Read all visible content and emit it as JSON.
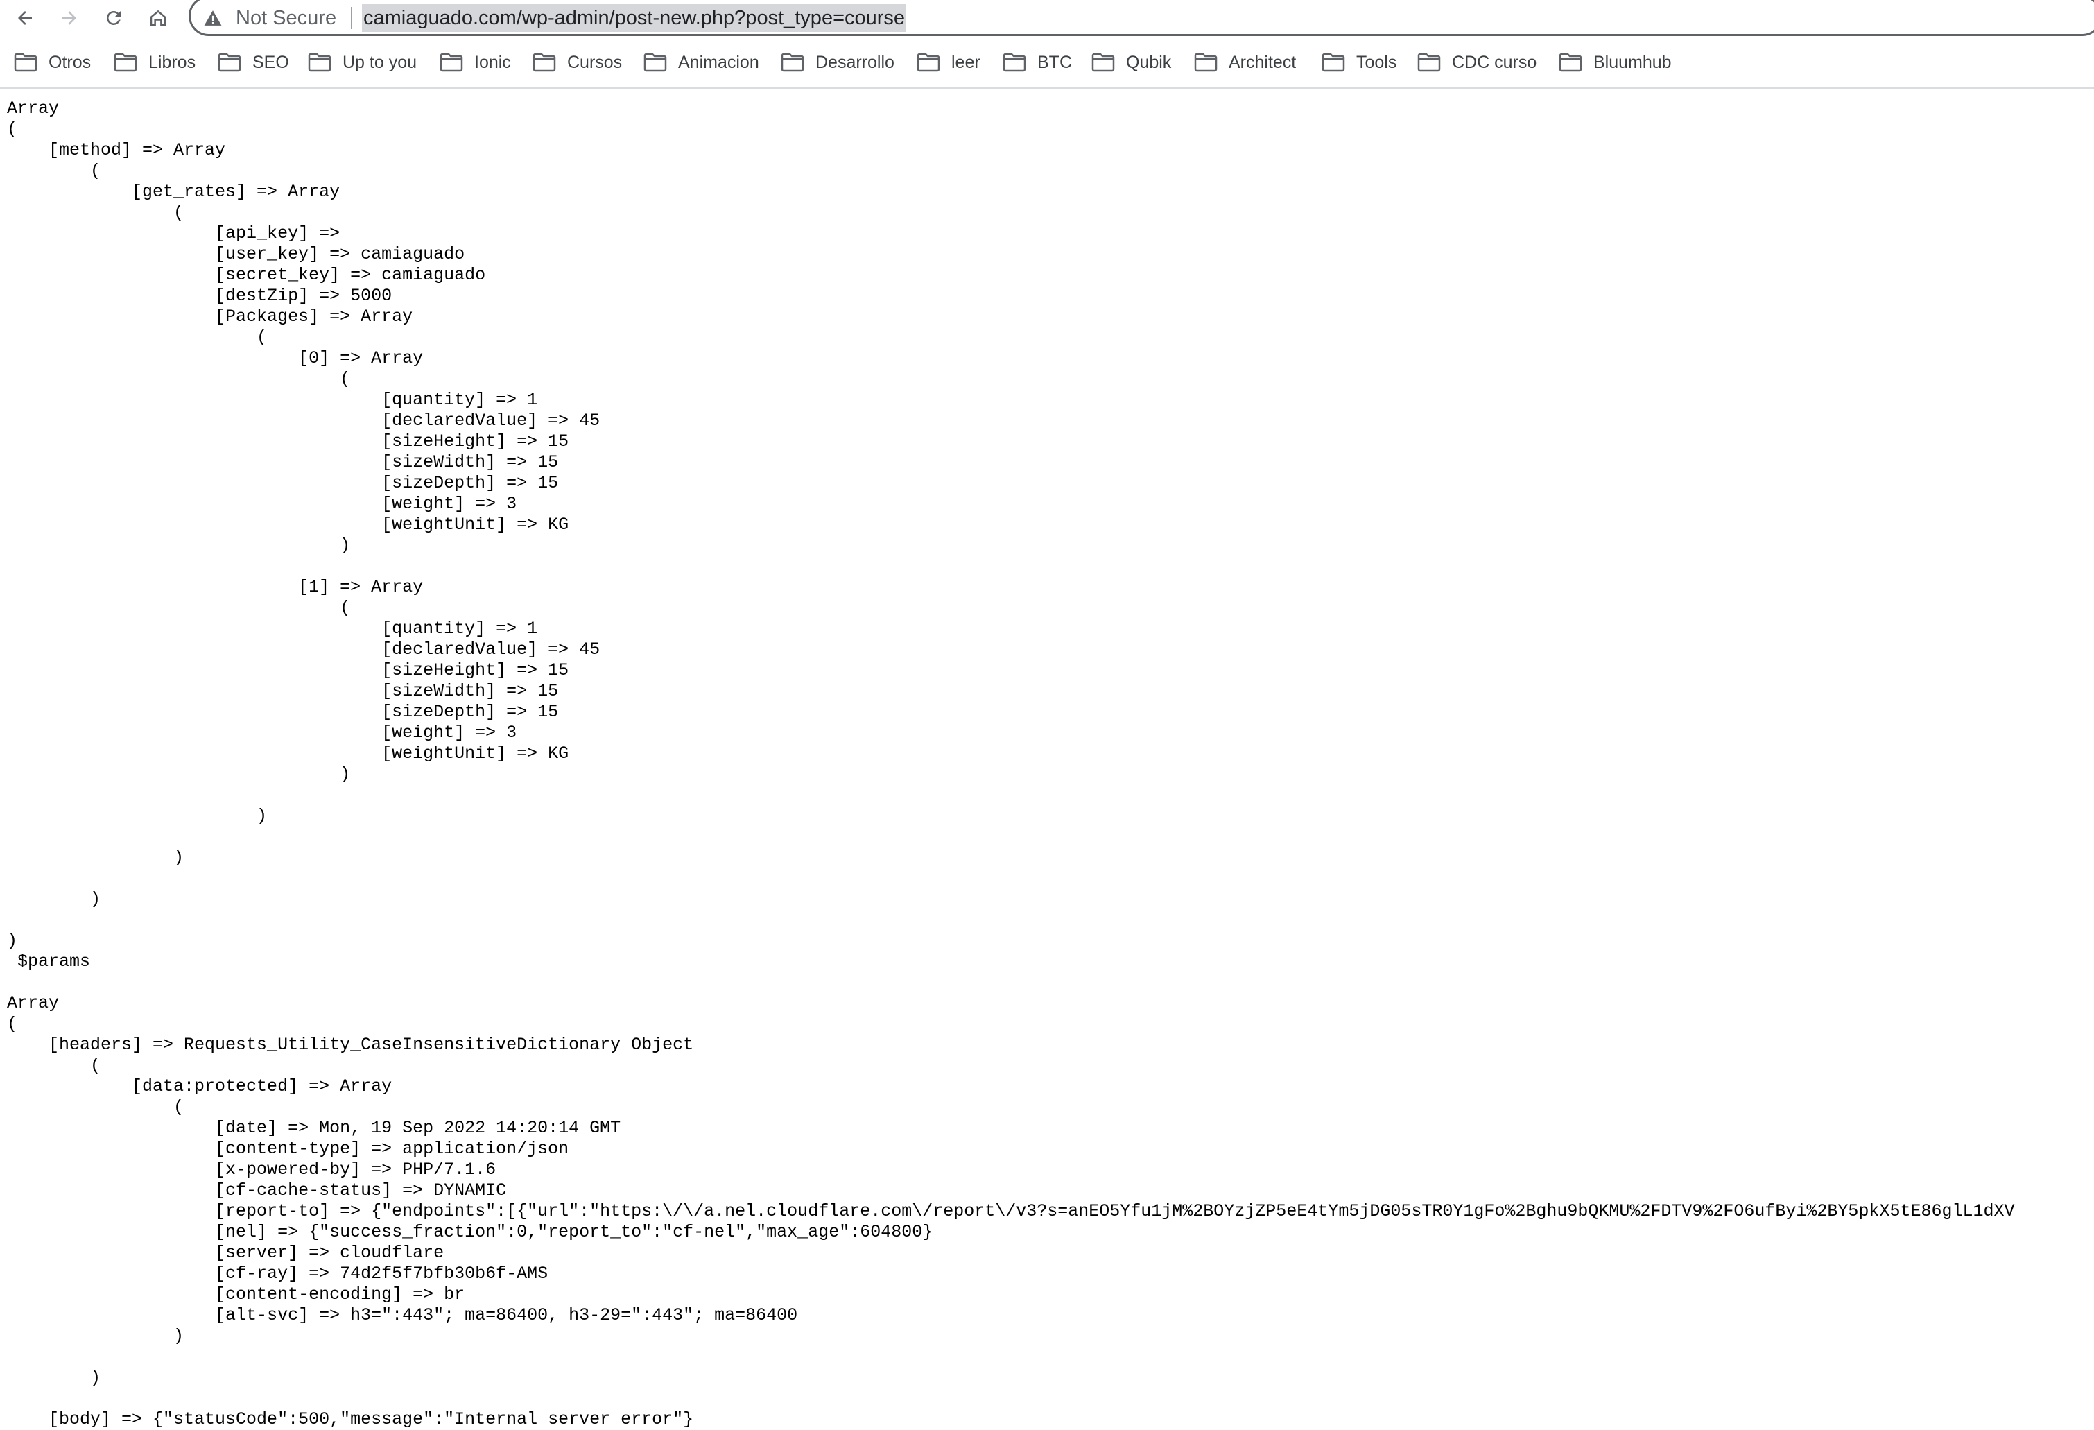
{
  "browser": {
    "security_label": "Not Secure",
    "url": "camiaguado.com/wp-admin/post-new.php?post_type=course"
  },
  "icons": {
    "back": "arrow-left-icon",
    "forward": "arrow-right-icon",
    "reload": "reload-icon",
    "home": "home-icon",
    "security": "warning-triangle-icon",
    "bookmark": "folder-icon"
  },
  "bookmarks": [
    "Otros",
    "Libros",
    "SEO",
    "Up to you",
    "Ionic",
    "Cursos",
    "Animacion",
    "Desarrollo",
    "leer",
    "BTC",
    "Qubik",
    "Architect",
    "Tools",
    "CDC curso",
    "Bluumhub"
  ],
  "page": {
    "dump_text": "Array\n(\n    [method] => Array\n        (\n            [get_rates] => Array\n                (\n                    [api_key] => \n                    [user_key] => camiaguado\n                    [secret_key] => camiaguado\n                    [destZip] => 5000\n                    [Packages] => Array\n                        (\n                            [0] => Array\n                                (\n                                    [quantity] => 1\n                                    [declaredValue] => 45\n                                    [sizeHeight] => 15\n                                    [sizeWidth] => 15\n                                    [sizeDepth] => 15\n                                    [weight] => 3\n                                    [weightUnit] => KG\n                                )\n\n                            [1] => Array\n                                (\n                                    [quantity] => 1\n                                    [declaredValue] => 45\n                                    [sizeHeight] => 15\n                                    [sizeWidth] => 15\n                                    [sizeDepth] => 15\n                                    [weight] => 3\n                                    [weightUnit] => KG\n                                )\n\n                        )\n\n                )\n\n        )\n\n)\n $params\n\nArray\n(\n    [headers] => Requests_Utility_CaseInsensitiveDictionary Object\n        (\n            [data:protected] => Array\n                (\n                    [date] => Mon, 19 Sep 2022 14:20:14 GMT\n                    [content-type] => application/json\n                    [x-powered-by] => PHP/7.1.6\n                    [cf-cache-status] => DYNAMIC\n                    [report-to] => {\"endpoints\":[{\"url\":\"https:\\/\\/a.nel.cloudflare.com\\/report\\/v3?s=anEO5Yfu1jM%2BOYzjZP5eE4tYm5jDG05sTR0Y1gFo%2Bghu9bQKMU%2FDTV9%2FO6ufByi%2BY5pkX5tE86glL1dXV\n                    [nel] => {\"success_fraction\":0,\"report_to\":\"cf-nel\",\"max_age\":604800}\n                    [server] => cloudflare\n                    [cf-ray] => 74d2f5f7bfb30b6f-AMS\n                    [content-encoding] => br\n                    [alt-svc] => h3=\":443\"; ma=86400, h3-29=\":443\"; ma=86400\n                )\n\n        )\n\n    [body] => {\"statusCode\":500,\"message\":\"Internal server error\"}"
  }
}
